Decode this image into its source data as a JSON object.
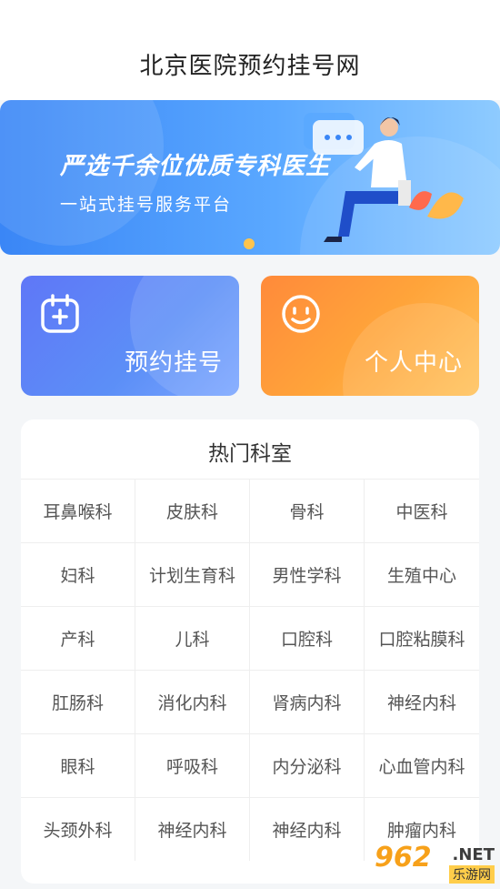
{
  "header": {
    "title": "北京医院预约挂号网"
  },
  "banner": {
    "headline": "严选千余位优质专科医生",
    "subtitle": "一站式挂号服务平台"
  },
  "cards": {
    "booking": {
      "label": "预约挂号",
      "icon": "calendar-plus-icon"
    },
    "personal": {
      "label": "个人中心",
      "icon": "smiley-face-icon"
    }
  },
  "departments": {
    "title": "热门科室",
    "items": [
      "耳鼻喉科",
      "皮肤科",
      "骨科",
      "中医科",
      "妇科",
      "计划生育科",
      "男性学科",
      "生殖中心",
      "产科",
      "儿科",
      "口腔科",
      "口腔粘膜科",
      "肛肠科",
      "消化内科",
      "肾病内科",
      "神经内科",
      "眼科",
      "呼吸科",
      "内分泌科",
      "心血管内科",
      "头颈外科",
      "神经内科",
      "神经内科",
      "肿瘤内科"
    ]
  },
  "watermark": {
    "logo": "962",
    "net": ".NET",
    "sub": "乐游网"
  },
  "colors": {
    "banner_blue": "#3a86f6",
    "booking_card": "#5f77f7",
    "personal_card": "#ff8a3a"
  }
}
